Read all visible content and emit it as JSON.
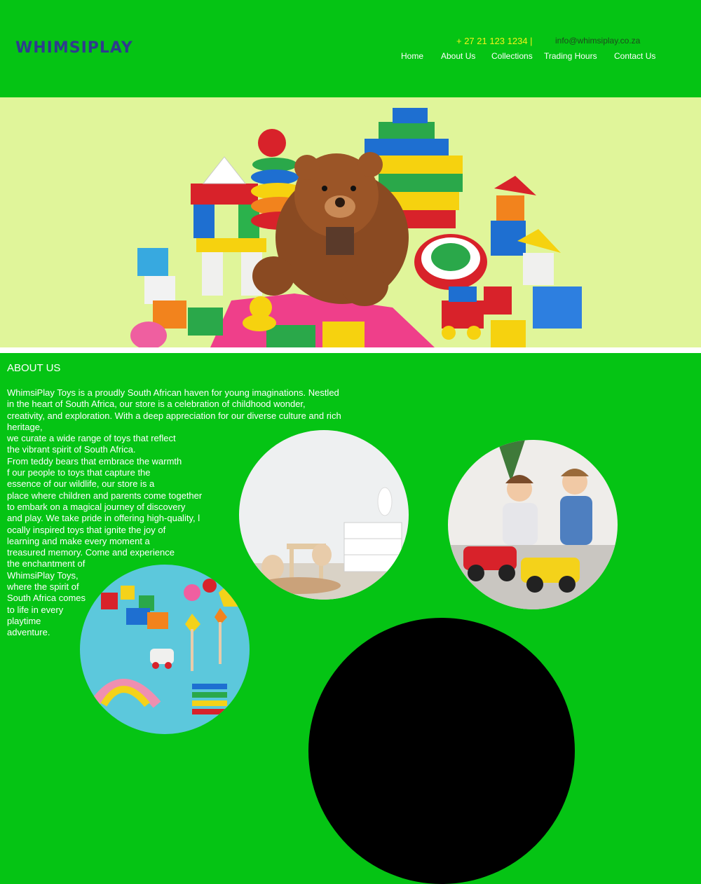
{
  "header": {
    "logo": "WHIMSIPLAY",
    "phone": "+ 27 21 123 1234 |",
    "email": "info@whimsiplay.co.za",
    "nav": [
      "Home",
      "About Us",
      "Collections",
      "Trading Hours",
      "Contact Us"
    ]
  },
  "colors": {
    "background": "#05c414",
    "hero_background": "#e0f59a",
    "logo": "#2f3b8e",
    "phone": "#f4f21a"
  },
  "about": {
    "title": "ABOUT US",
    "paragraph": "WhimsiPlay Toys is a proudly South African haven for young imaginations. Nestled\nin the heart of South Africa, our store is a celebration of childhood wonder,\ncreativity, and exploration. With a deep appreciation for our diverse culture and rich\nheritage,\nwe curate a wide range of toys that reflect\nthe vibrant spirit of South Africa.\nFrom teddy bears that embrace the warmth\nf our people to toys that capture the\nessence of our wildlife, our store is a\nplace where children and parents come together\nto embark on a magical journey of discovery\nand play. We take pride in offering high-quality, l\nocally inspired toys that ignite the joy of\nlearning and make every moment a\ntreasured memory. Come and experience\nthe enchantment of\nWhimsiPlay Toys,\nwhere the spirit of\nSouth Africa comes\nto life in every\nplaytime\nadventure."
  }
}
